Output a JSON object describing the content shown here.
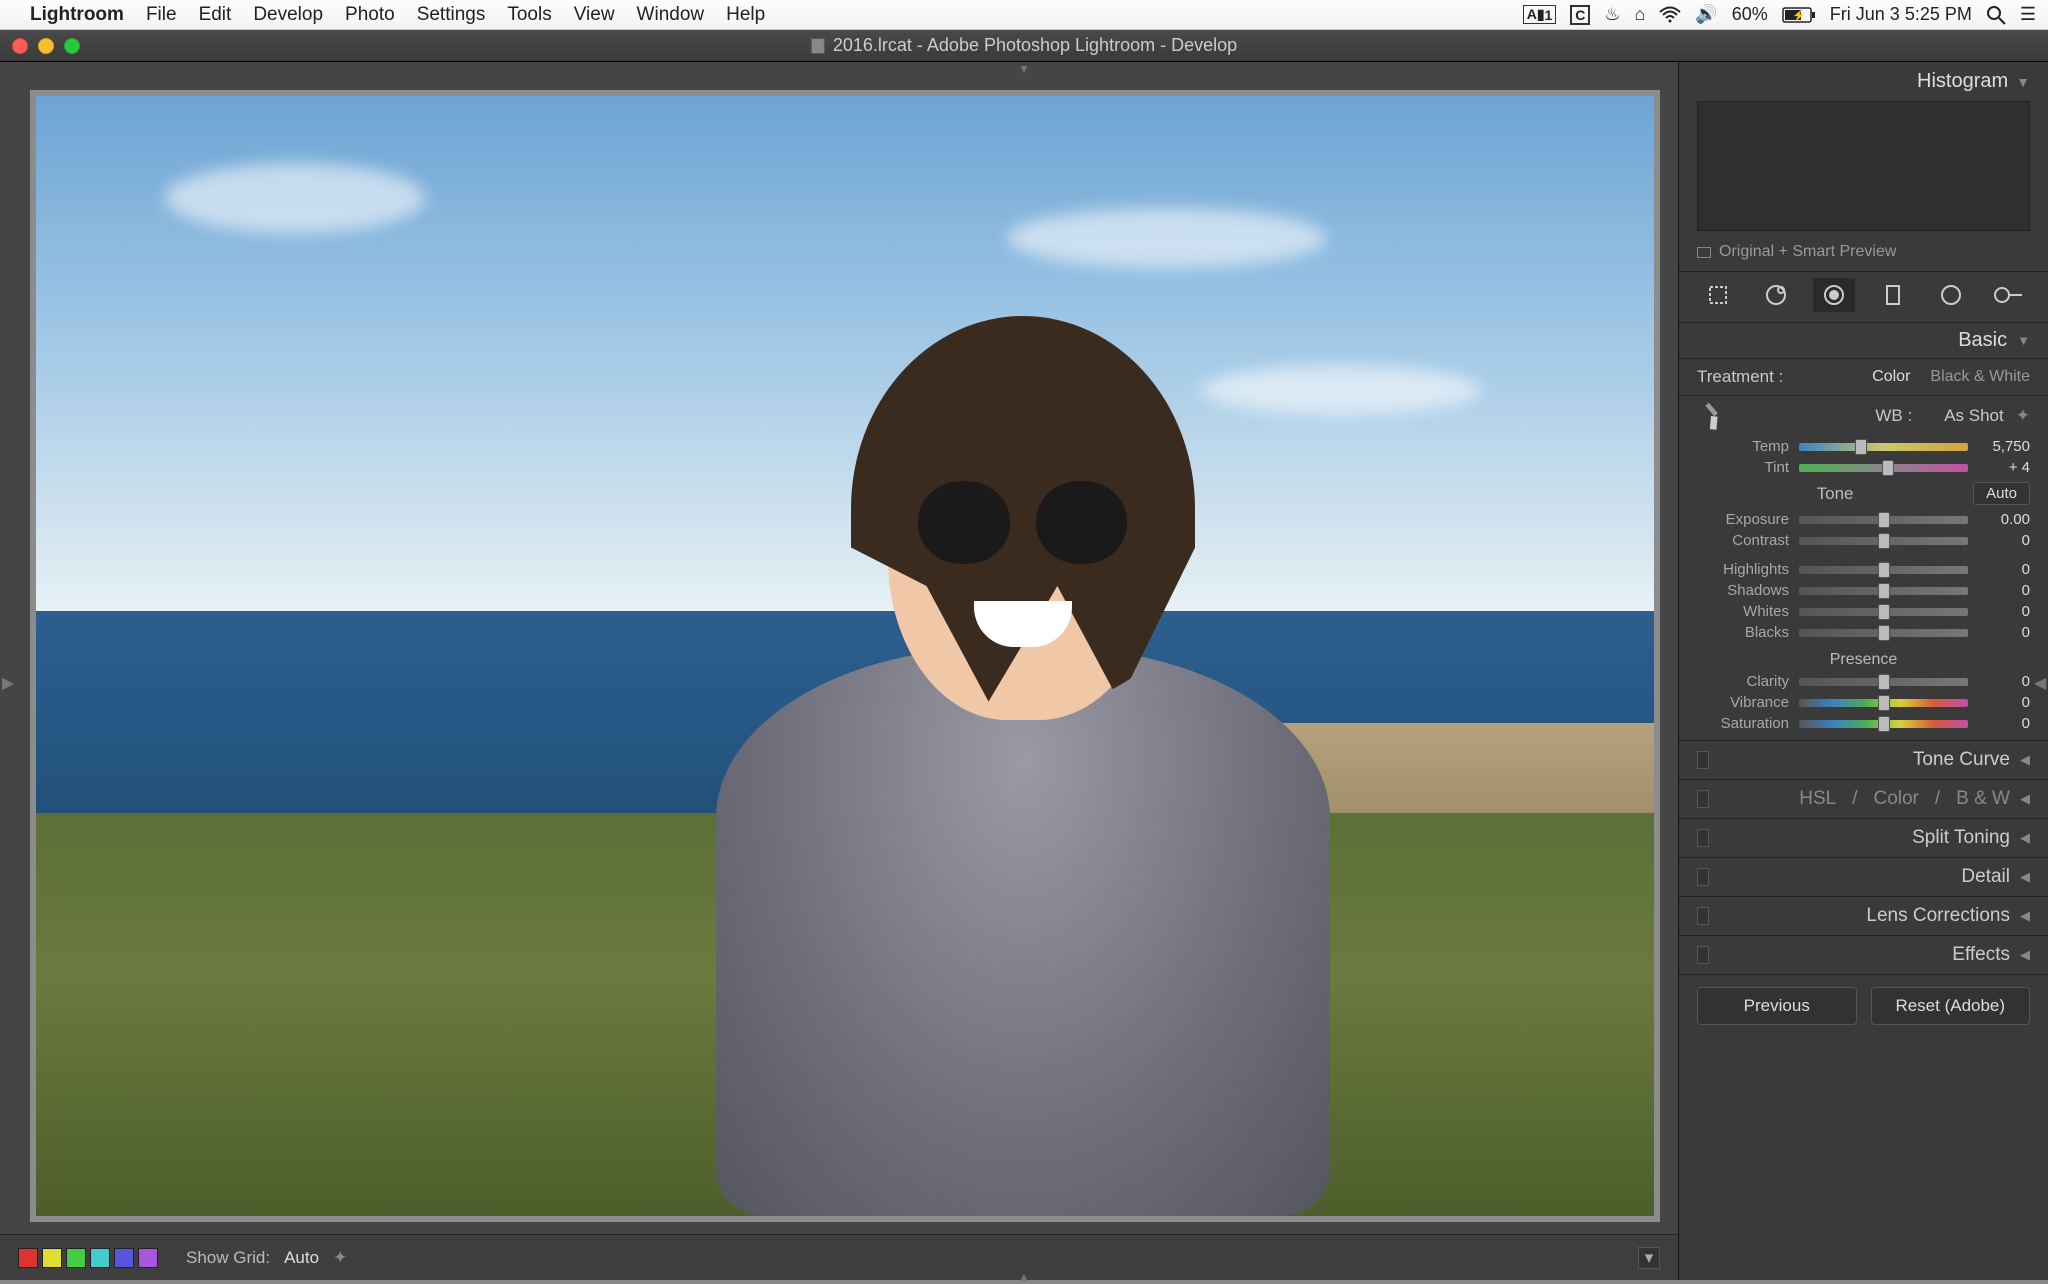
{
  "menubar": {
    "app": "Lightroom",
    "items": [
      "File",
      "Edit",
      "Develop",
      "Photo",
      "Settings",
      "Tools",
      "View",
      "Window",
      "Help"
    ],
    "status": {
      "adobe_badge": "1",
      "battery": "60%",
      "battery_icon": "⚡",
      "datetime": "Fri Jun 3  5:25 PM"
    }
  },
  "window": {
    "title": "2016.lrcat - Adobe Photoshop Lightroom - Develop"
  },
  "bottom_toolbar": {
    "colors": [
      "#d33",
      "#dd3",
      "#4c4",
      "#4cc",
      "#55d",
      "#a5d"
    ],
    "grid_label": "Show Grid:",
    "grid_value": "Auto"
  },
  "panel": {
    "histogram_title": "Histogram",
    "preview_label": "Original + Smart Preview",
    "basic_title": "Basic",
    "treatment_label": "Treatment :",
    "treatment_color": "Color",
    "treatment_bw": "Black & White",
    "wb_label": "WB :",
    "wb_value": "As Shot",
    "temp_label": "Temp",
    "temp_value": "5,750",
    "tint_label": "Tint",
    "tint_value": "+ 4",
    "tone_label": "Tone",
    "auto_label": "Auto",
    "exposure_label": "Exposure",
    "exposure_value": "0.00",
    "contrast_label": "Contrast",
    "contrast_value": "0",
    "highlights_label": "Highlights",
    "highlights_value": "0",
    "shadows_label": "Shadows",
    "shadows_value": "0",
    "whites_label": "Whites",
    "whites_value": "0",
    "blacks_label": "Blacks",
    "blacks_value": "0",
    "presence_label": "Presence",
    "clarity_label": "Clarity",
    "clarity_value": "0",
    "vibrance_label": "Vibrance",
    "vibrance_value": "0",
    "saturation_label": "Saturation",
    "saturation_value": "0",
    "collapsed": {
      "tone_curve": "Tone Curve",
      "hsl": "HSL",
      "color": "Color",
      "bw": "B & W",
      "split": "Split Toning",
      "detail": "Detail",
      "lens": "Lens Corrections",
      "effects": "Effects"
    },
    "buttons": {
      "previous": "Previous",
      "reset": "Reset (Adobe)"
    }
  }
}
